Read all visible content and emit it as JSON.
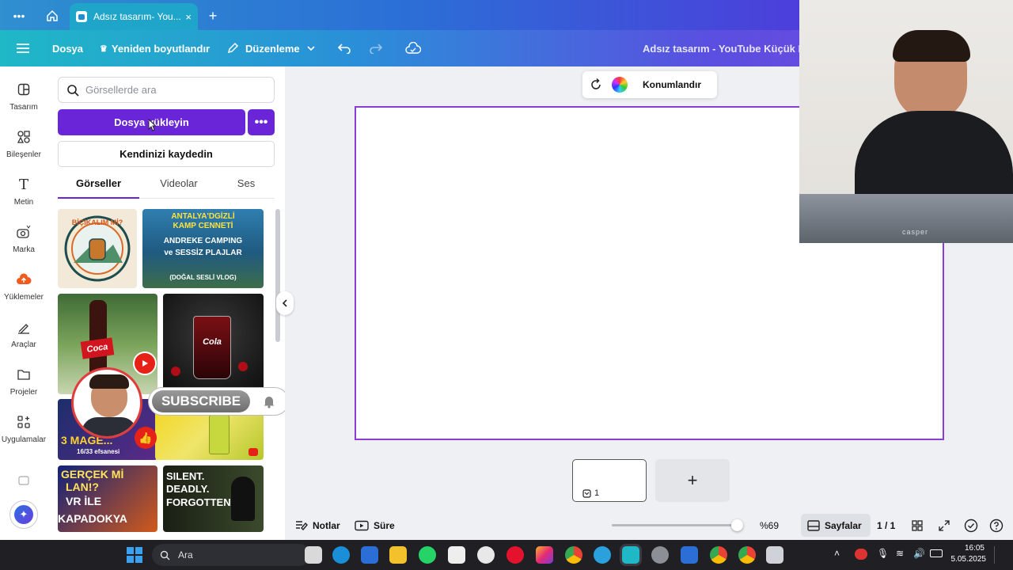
{
  "browser": {
    "tab_title": "Adsız tasarım- You...",
    "close": "×",
    "new_tab": "+"
  },
  "header": {
    "file": "Dosya",
    "resize": "Yeniden boyutlandır",
    "edit": "Düzenleme",
    "doc_title": "Adsız tasarım - YouTube Küçük Resi",
    "crown": "♛"
  },
  "rail": {
    "items": [
      {
        "label": "Tasarım",
        "icon": "design-icon"
      },
      {
        "label": "Bileşenler",
        "icon": "elements-icon"
      },
      {
        "label": "Metin",
        "icon": "text-icon"
      },
      {
        "label": "Marka",
        "icon": "brand-icon"
      },
      {
        "label": "Yüklemeler",
        "icon": "uploads-icon"
      },
      {
        "label": "Araçlar",
        "icon": "tools-icon"
      },
      {
        "label": "Projeler",
        "icon": "projects-icon"
      },
      {
        "label": "Uygulamalar",
        "icon": "apps-icon"
      }
    ]
  },
  "panel": {
    "search_placeholder": "Görsellerde ara",
    "upload_label": "Dosya yükleyin",
    "more_label": "•••",
    "record_label": "Kendinizi kaydedin",
    "tabs": [
      "Görseller",
      "Videolar",
      "Ses"
    ],
    "thumbs": {
      "t1": "BİÇIKALIM Mİ?",
      "t2_lines": [
        "ANTALYA'DGİZLİ",
        "KAMP CENNETİ",
        "ANDREKE CAMPING",
        "ve SESSİZ PLAJLAR",
        "(DOĞAL SESLİ VLOG)"
      ],
      "t3": "Coca",
      "t4": "Cola",
      "t5_lines": [
        "3 MAGE...",
        "16/33 efsanesi"
      ],
      "t7_lines": [
        "GERÇEK Mİ",
        "LAN!?",
        "VR İLE",
        "KAPADOKYA"
      ],
      "t8_lines": [
        "SILENT.",
        "DEADLY.",
        "FORGOTTEN"
      ],
      "subscribe": "SUBSCRIBE"
    }
  },
  "canvas": {
    "position_label": "Konumlandır",
    "page_number": "1",
    "add_page": "+"
  },
  "bottombar": {
    "notes": "Notlar",
    "duration": "Süre",
    "zoom": "%69",
    "pages": "Sayfalar",
    "page_count": "1 / 1",
    "zoom_value": 0.69
  },
  "webcam": {
    "laptop_brand": "casper"
  },
  "taskbar": {
    "search": "Ara",
    "time": "16:05",
    "date": "5.05.2025"
  }
}
